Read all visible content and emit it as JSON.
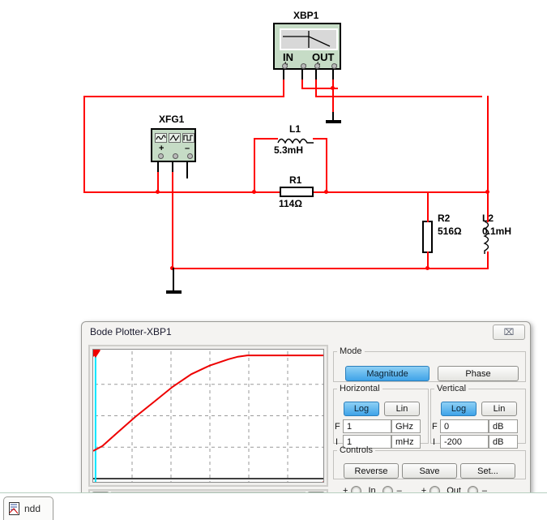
{
  "schematic": {
    "instruments": [
      {
        "ref": "XBP1",
        "ports": [
          "IN",
          "OUT"
        ],
        "pin_signs": [
          "+",
          "–",
          "+",
          "–"
        ]
      },
      {
        "ref": "XFG1",
        "pin_signs": [
          "+",
          "",
          "–"
        ],
        "wave_icons": [
          "sine-wave-icon",
          "triangle-wave-icon",
          "square-wave-icon"
        ]
      }
    ],
    "components": [
      {
        "ref": "L1",
        "value": "5.3mH",
        "type": "inductor"
      },
      {
        "ref": "R1",
        "value": "114Ω",
        "type": "resistor"
      },
      {
        "ref": "R2",
        "value": "516Ω",
        "type": "resistor"
      },
      {
        "ref": "L2",
        "value": "0.1mH",
        "type": "inductor"
      }
    ],
    "wire_color": "#ff0000"
  },
  "dialog": {
    "title": "Bode Plotter-XBP1",
    "close_label": "⌧",
    "mode": {
      "legend": "Mode",
      "magnitude_label": "Magnitude",
      "phase_label": "Phase",
      "selected": "Magnitude"
    },
    "horizontal": {
      "legend": "Horizontal",
      "log_label": "Log",
      "lin_label": "Lin",
      "selected": "Log",
      "f_label": "F",
      "f_value": "1",
      "f_unit": "GHz",
      "i_label": "I",
      "i_value": "1",
      "i_unit": "mHz"
    },
    "vertical": {
      "legend": "Vertical",
      "log_label": "Log",
      "lin_label": "Lin",
      "selected": "Log",
      "f_label": "F",
      "f_value": "0",
      "f_unit": "dB",
      "i_label": "I",
      "i_value": "-200",
      "i_unit": "dB"
    },
    "controls": {
      "legend": "Controls",
      "reverse_label": "Reverse",
      "save_label": "Save",
      "set_label": "Set..."
    },
    "terminals": {
      "in_label": "In",
      "out_label": "Out",
      "plus": "+",
      "minus": "–"
    },
    "scrollbar": {
      "left_arrow": "◀",
      "right_arrow": "▶"
    },
    "accent_selected": "#3fa3e8",
    "trace_color": "#ee0000",
    "cursor_color": "#00e5ff"
  },
  "chart_data": {
    "type": "line",
    "title": "",
    "xlabel": "",
    "ylabel": "",
    "x": [
      0,
      4,
      10,
      18,
      26,
      34,
      42,
      50,
      58,
      62,
      66,
      70,
      78,
      86,
      94,
      100
    ],
    "values": [
      22,
      26,
      36,
      49,
      61,
      73,
      83,
      90,
      95,
      97,
      98,
      98,
      98,
      98,
      98,
      98
    ],
    "xlim": [
      0,
      100
    ],
    "ylim": [
      0,
      100
    ],
    "grid": true,
    "legend": "none",
    "cursor_x": 1,
    "series": [
      {
        "name": "Magnitude",
        "color": "#ee0000"
      }
    ]
  },
  "taskbar": {
    "tab_label": "ndd",
    "tab_icon": "document-icon"
  }
}
